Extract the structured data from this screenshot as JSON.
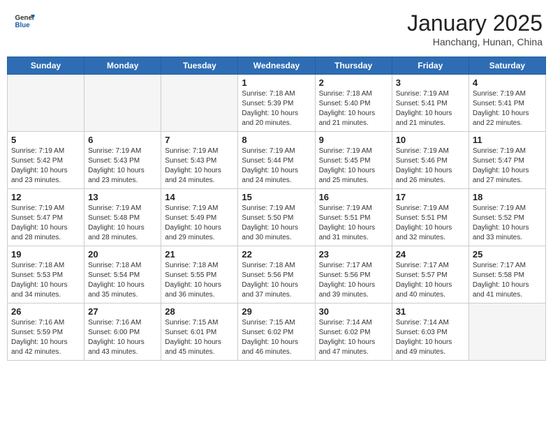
{
  "header": {
    "logo_general": "General",
    "logo_blue": "Blue",
    "month_title": "January 2025",
    "subtitle": "Hanchang, Hunan, China"
  },
  "days_of_week": [
    "Sunday",
    "Monday",
    "Tuesday",
    "Wednesday",
    "Thursday",
    "Friday",
    "Saturday"
  ],
  "weeks": [
    [
      {
        "day": "",
        "info": ""
      },
      {
        "day": "",
        "info": ""
      },
      {
        "day": "",
        "info": ""
      },
      {
        "day": "1",
        "info": "Sunrise: 7:18 AM\nSunset: 5:39 PM\nDaylight: 10 hours\nand 20 minutes."
      },
      {
        "day": "2",
        "info": "Sunrise: 7:18 AM\nSunset: 5:40 PM\nDaylight: 10 hours\nand 21 minutes."
      },
      {
        "day": "3",
        "info": "Sunrise: 7:19 AM\nSunset: 5:41 PM\nDaylight: 10 hours\nand 21 minutes."
      },
      {
        "day": "4",
        "info": "Sunrise: 7:19 AM\nSunset: 5:41 PM\nDaylight: 10 hours\nand 22 minutes."
      }
    ],
    [
      {
        "day": "5",
        "info": "Sunrise: 7:19 AM\nSunset: 5:42 PM\nDaylight: 10 hours\nand 23 minutes."
      },
      {
        "day": "6",
        "info": "Sunrise: 7:19 AM\nSunset: 5:43 PM\nDaylight: 10 hours\nand 23 minutes."
      },
      {
        "day": "7",
        "info": "Sunrise: 7:19 AM\nSunset: 5:43 PM\nDaylight: 10 hours\nand 24 minutes."
      },
      {
        "day": "8",
        "info": "Sunrise: 7:19 AM\nSunset: 5:44 PM\nDaylight: 10 hours\nand 24 minutes."
      },
      {
        "day": "9",
        "info": "Sunrise: 7:19 AM\nSunset: 5:45 PM\nDaylight: 10 hours\nand 25 minutes."
      },
      {
        "day": "10",
        "info": "Sunrise: 7:19 AM\nSunset: 5:46 PM\nDaylight: 10 hours\nand 26 minutes."
      },
      {
        "day": "11",
        "info": "Sunrise: 7:19 AM\nSunset: 5:47 PM\nDaylight: 10 hours\nand 27 minutes."
      }
    ],
    [
      {
        "day": "12",
        "info": "Sunrise: 7:19 AM\nSunset: 5:47 PM\nDaylight: 10 hours\nand 28 minutes."
      },
      {
        "day": "13",
        "info": "Sunrise: 7:19 AM\nSunset: 5:48 PM\nDaylight: 10 hours\nand 28 minutes."
      },
      {
        "day": "14",
        "info": "Sunrise: 7:19 AM\nSunset: 5:49 PM\nDaylight: 10 hours\nand 29 minutes."
      },
      {
        "day": "15",
        "info": "Sunrise: 7:19 AM\nSunset: 5:50 PM\nDaylight: 10 hours\nand 30 minutes."
      },
      {
        "day": "16",
        "info": "Sunrise: 7:19 AM\nSunset: 5:51 PM\nDaylight: 10 hours\nand 31 minutes."
      },
      {
        "day": "17",
        "info": "Sunrise: 7:19 AM\nSunset: 5:51 PM\nDaylight: 10 hours\nand 32 minutes."
      },
      {
        "day": "18",
        "info": "Sunrise: 7:19 AM\nSunset: 5:52 PM\nDaylight: 10 hours\nand 33 minutes."
      }
    ],
    [
      {
        "day": "19",
        "info": "Sunrise: 7:18 AM\nSunset: 5:53 PM\nDaylight: 10 hours\nand 34 minutes."
      },
      {
        "day": "20",
        "info": "Sunrise: 7:18 AM\nSunset: 5:54 PM\nDaylight: 10 hours\nand 35 minutes."
      },
      {
        "day": "21",
        "info": "Sunrise: 7:18 AM\nSunset: 5:55 PM\nDaylight: 10 hours\nand 36 minutes."
      },
      {
        "day": "22",
        "info": "Sunrise: 7:18 AM\nSunset: 5:56 PM\nDaylight: 10 hours\nand 37 minutes."
      },
      {
        "day": "23",
        "info": "Sunrise: 7:17 AM\nSunset: 5:56 PM\nDaylight: 10 hours\nand 39 minutes."
      },
      {
        "day": "24",
        "info": "Sunrise: 7:17 AM\nSunset: 5:57 PM\nDaylight: 10 hours\nand 40 minutes."
      },
      {
        "day": "25",
        "info": "Sunrise: 7:17 AM\nSunset: 5:58 PM\nDaylight: 10 hours\nand 41 minutes."
      }
    ],
    [
      {
        "day": "26",
        "info": "Sunrise: 7:16 AM\nSunset: 5:59 PM\nDaylight: 10 hours\nand 42 minutes."
      },
      {
        "day": "27",
        "info": "Sunrise: 7:16 AM\nSunset: 6:00 PM\nDaylight: 10 hours\nand 43 minutes."
      },
      {
        "day": "28",
        "info": "Sunrise: 7:15 AM\nSunset: 6:01 PM\nDaylight: 10 hours\nand 45 minutes."
      },
      {
        "day": "29",
        "info": "Sunrise: 7:15 AM\nSunset: 6:02 PM\nDaylight: 10 hours\nand 46 minutes."
      },
      {
        "day": "30",
        "info": "Sunrise: 7:14 AM\nSunset: 6:02 PM\nDaylight: 10 hours\nand 47 minutes."
      },
      {
        "day": "31",
        "info": "Sunrise: 7:14 AM\nSunset: 6:03 PM\nDaylight: 10 hours\nand 49 minutes."
      },
      {
        "day": "",
        "info": ""
      }
    ]
  ]
}
